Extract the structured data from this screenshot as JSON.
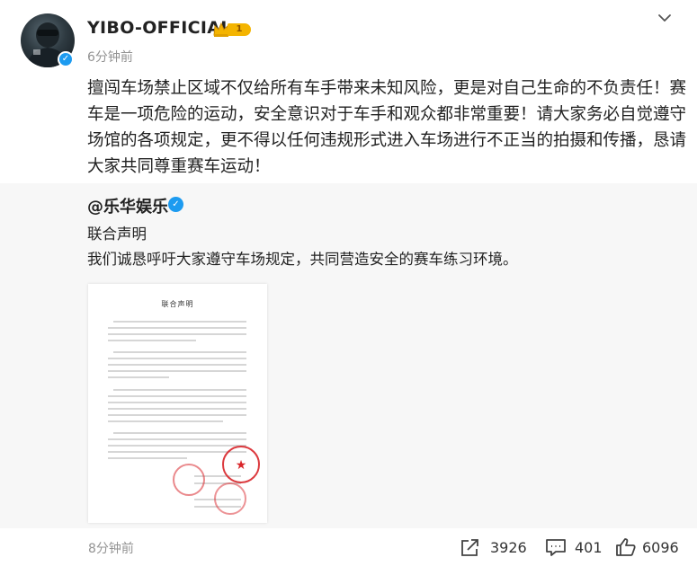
{
  "author": {
    "name": "YIBO-OFFICIAL",
    "level": "1",
    "time": "6分钟前"
  },
  "post": {
    "lines": [
      "擅闯车场禁止区域不仅给所有车手带来未知风险，更是对自己生命的不负责任！赛",
      "车是一项危险的运动，安全意识对于车手和观众都非常重要！请大家务必自觉遵守",
      "场馆的各项规定，更不得以任何违规形式进入车场进行不正当的拍摄和传播，恳请",
      "大家共同尊重赛车运动！"
    ]
  },
  "repost": {
    "user": "@乐华娱乐",
    "title": "联合声明",
    "text": "我们诚恳呼吁大家遵守车场规定，共同营造安全的赛车练习环境。",
    "document": {
      "title": "联合声明"
    }
  },
  "footer": {
    "time": "8分钟前",
    "shares": "3926",
    "comments": "401",
    "likes": "6096"
  },
  "icons": {
    "menu": "chevron-down-icon",
    "verified": "verified-icon",
    "crown": "crown-icon",
    "share": "share-icon",
    "comment": "comment-icon",
    "like": "like-icon"
  },
  "colors": {
    "verified": "#1d9bf0",
    "badge": "#f4b400",
    "repost_bg": "#f7f7f7",
    "meta_text": "#939393",
    "stamp": "#d9252a"
  }
}
